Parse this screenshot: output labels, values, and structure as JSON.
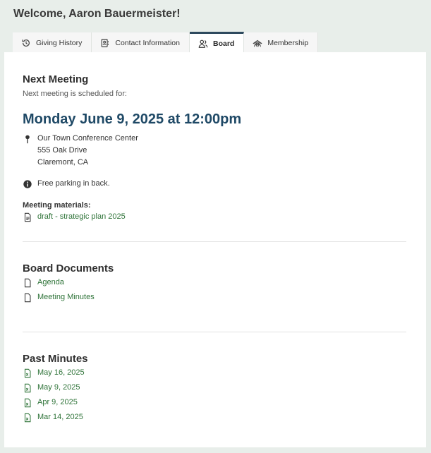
{
  "welcome": "Welcome, Aaron Bauermeister!",
  "tabs": [
    {
      "label": "Giving History",
      "icon": "history-icon"
    },
    {
      "label": "Contact Information",
      "icon": "contact-card-icon"
    },
    {
      "label": "Board",
      "icon": "people-icon",
      "active": true
    },
    {
      "label": "Membership",
      "icon": "membership-icon"
    }
  ],
  "next_meeting": {
    "title": "Next Meeting",
    "subtitle": "Next meeting is scheduled for:",
    "date": "Monday June 9, 2025 at 12:00pm",
    "location": {
      "line1": "Our Town Conference Center",
      "line2": "555 Oak Drive",
      "line3": "Claremont, CA"
    },
    "info": "Free parking in back.",
    "materials_label": "Meeting materials:",
    "materials": [
      {
        "label": "draft - strategic plan 2025"
      }
    ]
  },
  "board_documents": {
    "title": "Board Documents",
    "items": [
      {
        "label": "Agenda"
      },
      {
        "label": "Meeting Minutes"
      }
    ]
  },
  "past_minutes": {
    "title": "Past Minutes",
    "items": [
      {
        "label": "May 16, 2025"
      },
      {
        "label": "May 9, 2025"
      },
      {
        "label": "Apr 9, 2025"
      },
      {
        "label": "Mar 14, 2025"
      }
    ]
  },
  "colors": {
    "accent": "#1f4966",
    "link": "#2e7338",
    "tab_active_border": "#2e4a5e",
    "background": "#e8eeea"
  }
}
